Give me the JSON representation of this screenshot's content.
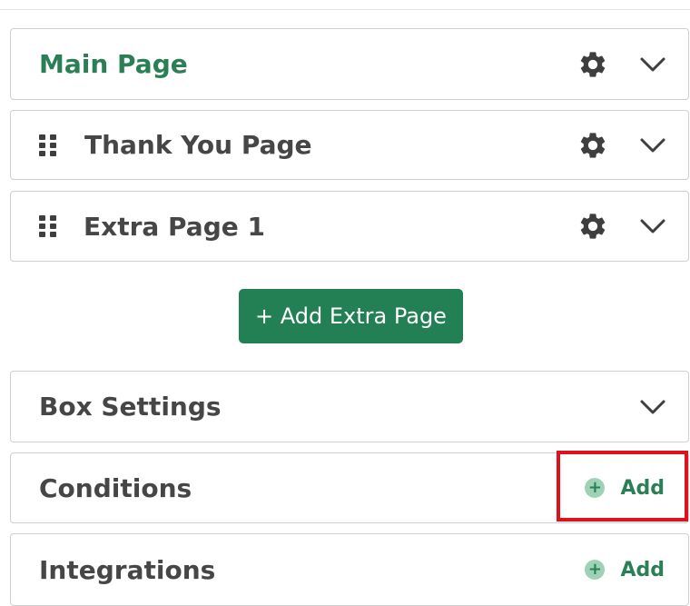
{
  "pages": [
    {
      "title": "Main Page",
      "active": true,
      "draggable": false
    },
    {
      "title": "Thank You Page",
      "active": false,
      "draggable": true
    },
    {
      "title": "Extra Page 1",
      "active": false,
      "draggable": true
    }
  ],
  "add_extra_page_label": "+ Add Extra Page",
  "sections": {
    "box_settings": {
      "title": "Box Settings"
    },
    "conditions": {
      "title": "Conditions",
      "add_label": "Add"
    },
    "integrations": {
      "title": "Integrations",
      "add_label": "Add"
    }
  },
  "icons": {
    "plus": "+",
    "settings": "gear-icon",
    "expand": "chevron-down-icon",
    "drag": "drag-handle-icon"
  },
  "colors": {
    "accent": "#237f54",
    "active_text": "#2a7f55",
    "text": "#464646",
    "plus_circle": "#9fd1b6",
    "highlight": "#e1111b"
  }
}
